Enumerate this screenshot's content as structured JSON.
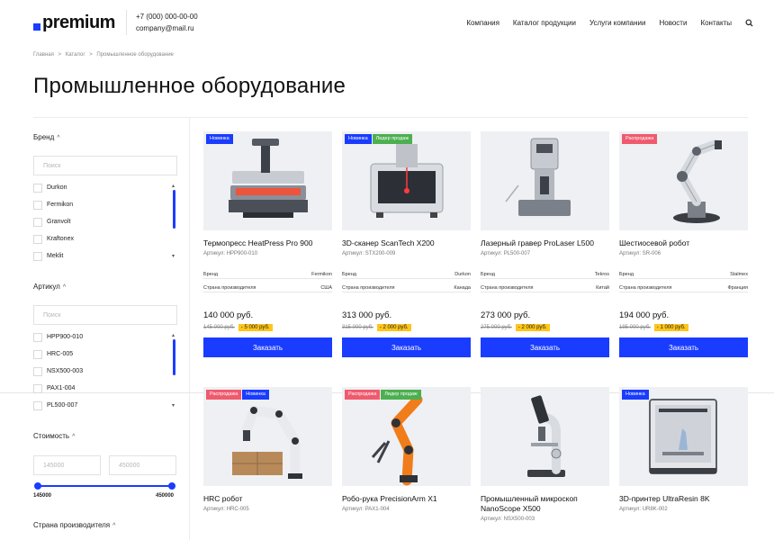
{
  "header": {
    "logo": "premium",
    "phone": "+7 (000) 000-00-00",
    "email": "company@mail.ru",
    "nav": [
      "Компания",
      "Каталог продукции",
      "Услуги компании",
      "Новости",
      "Контакты"
    ]
  },
  "breadcrumb": [
    "Главная",
    ">",
    "Каталог",
    ">",
    "Промышленное оборудование"
  ],
  "page_title": "Промышленное оборудование",
  "filters": {
    "brand": {
      "title": "Бренд",
      "placeholder": "Поиск",
      "items": [
        "Durkon",
        "Fermikon",
        "Granvolt",
        "Kraftonex",
        "Meklit"
      ]
    },
    "article": {
      "title": "Артикул",
      "placeholder": "Поиск",
      "items": [
        "HPP900-010",
        "HRC-005",
        "NSX500-003",
        "PAX1-004",
        "PL500-007"
      ]
    },
    "price": {
      "title": "Стоимость",
      "min_placeholder": "145000",
      "max_placeholder": "450000",
      "min_label": "145000",
      "max_label": "450000"
    },
    "country": {
      "title": "Страна производителя"
    }
  },
  "labels": {
    "brand": "Бренд",
    "country": "Страна производителя",
    "order": "Заказать"
  },
  "products": [
    {
      "badges": [
        {
          "text": "Новинка",
          "type": "new"
        }
      ],
      "name": "Термопресс HeatPress Pro 900",
      "article": "Артикул: HPP900-010",
      "brand": "Fermikon",
      "country": "США",
      "price": "140 000 руб.",
      "old_price": "145 000 руб.",
      "discount": "- 5 000 руб."
    },
    {
      "badges": [
        {
          "text": "Новинка",
          "type": "new"
        },
        {
          "text": "Лидер продаж",
          "type": "lead"
        }
      ],
      "name": "3D-сканер ScanTech X200",
      "article": "Артикул: STX200-009",
      "brand": "Durkon",
      "country": "Канада",
      "price": "313 000 руб.",
      "old_price": "315 000 руб.",
      "discount": "- 2 000 руб."
    },
    {
      "badges": [],
      "name": "Лазерный гравер ProLaser L500",
      "article": "Артикул: PL500-007",
      "brand": "Tekros",
      "country": "Китай",
      "price": "273 000 руб.",
      "old_price": "275 000 руб.",
      "discount": "- 2 000 руб."
    },
    {
      "badges": [
        {
          "text": "Распродажа",
          "type": "sale"
        }
      ],
      "name": "Шестиосевой робот",
      "article": "Артикул: SR-006",
      "brand": "Stalmex",
      "country": "Франция",
      "price": "194 000 руб.",
      "old_price": "195 000 руб.",
      "discount": "- 1 000 руб."
    },
    {
      "badges": [
        {
          "text": "Распродажа",
          "type": "sale"
        },
        {
          "text": "Новинка",
          "type": "new"
        }
      ],
      "name": "HRC робот",
      "article": "Артикул: HRC-005"
    },
    {
      "badges": [
        {
          "text": "Распродажа",
          "type": "sale"
        },
        {
          "text": "Лидер продаж",
          "type": "lead"
        }
      ],
      "name": "Робо-рука PrecisionArm X1",
      "article": "Артикул: PAX1-004"
    },
    {
      "badges": [],
      "name": "Промышленный микроскоп NanoScope X500",
      "article": "Артикул: NSX500-003"
    },
    {
      "badges": [
        {
          "text": "Новинка",
          "type": "new"
        }
      ],
      "name": "3D-принтер UltraResin 8K",
      "article": "Артикул: UR8K-002"
    }
  ],
  "colors": {
    "accent": "#1a3cff",
    "badge_new": "#1a3cff",
    "badge_lead": "#4caf50",
    "badge_sale": "#f05a6e",
    "discount": "#ffc61a"
  }
}
